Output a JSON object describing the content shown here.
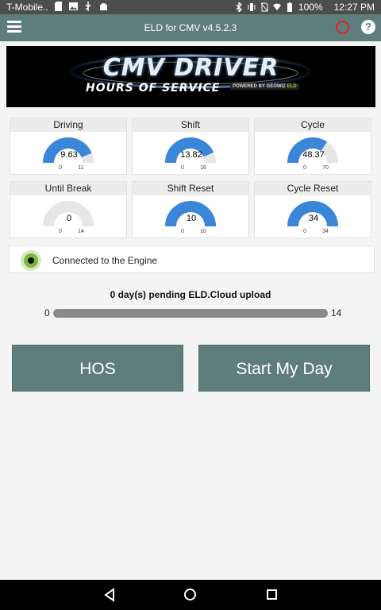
{
  "status_bar": {
    "carrier": "T-Mobile..",
    "battery": "100%",
    "time": "12:27 PM"
  },
  "app_bar": {
    "title": "ELD for CMV v4.5.2.3",
    "help": "?"
  },
  "banner": {
    "title": "CMV DRIVER",
    "subtitle": "HOURS OF SERVICE",
    "powered_by": "POWERED BY GEOWIZ",
    "powered_brand": "ELD"
  },
  "gauges": [
    {
      "label": "Driving",
      "value": "9.63",
      "min": "0",
      "max": "11",
      "fraction": 0.875
    },
    {
      "label": "Shift",
      "value": "13.82",
      "min": "0",
      "max": "16",
      "fraction": 0.864
    },
    {
      "label": "Cycle",
      "value": "48.37",
      "min": "0",
      "max": "70",
      "fraction": 0.691
    },
    {
      "label": "Until Break",
      "value": "0",
      "min": "0",
      "max": "14",
      "fraction": 0
    },
    {
      "label": "Shift Reset",
      "value": "10",
      "min": "0",
      "max": "10",
      "fraction": 1
    },
    {
      "label": "Cycle Reset",
      "value": "34",
      "min": "0",
      "max": "34",
      "fraction": 1
    }
  ],
  "engine": {
    "status": "Connected to the Engine"
  },
  "upload": {
    "pending_text": "0 day(s) pending ELD.Cloud upload",
    "min": "0",
    "max": "14",
    "fraction": 0
  },
  "buttons": {
    "hos": "HOS",
    "start_day": "Start My Day"
  },
  "colors": {
    "app_bar": "#5e7e7c",
    "gauge_fill": "#3a86d8",
    "gauge_track": "#e6e6e6",
    "record": "#e8202a",
    "engine_ok": "#7cb83c"
  }
}
